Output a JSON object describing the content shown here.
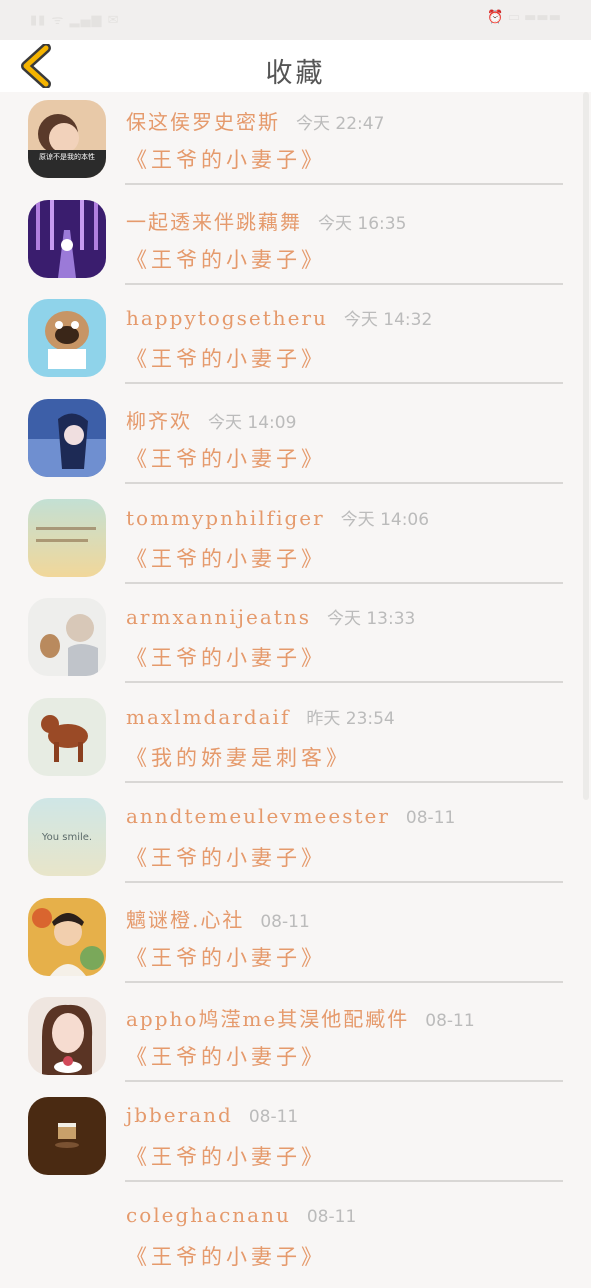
{
  "header": {
    "title": "收藏",
    "back_icon": "chevron-left-icon",
    "accent_color": "#f5b400"
  },
  "colors": {
    "text_accent": "#e59a6c",
    "time_gray": "#bbbbbb"
  },
  "favorites": [
    {
      "user": "保这侯罗史密斯",
      "time": "今天 22:47",
      "work": "《王爷的小妻子》",
      "avatar": "woman-portrait-avatar",
      "avatar_caption": "原谅不是我的本性"
    },
    {
      "user": "一起透来伴跳藕舞",
      "time": "今天 16:35",
      "work": "《王爷的小妻子》",
      "avatar": "purple-hall-avatar"
    },
    {
      "user": "happytogsetheru",
      "time": "今天 14:32",
      "work": "《王爷的小妻子》",
      "avatar": "pug-dog-avatar"
    },
    {
      "user": "柳齐欢",
      "time": "今天 14:09",
      "work": "《王爷的小妻子》",
      "avatar": "anime-girl-avatar"
    },
    {
      "user": "tommypnhilfiger",
      "time": "今天 14:06",
      "work": "《王爷的小妻子》",
      "avatar": "text-card-avatar"
    },
    {
      "user": "armxannijeatns",
      "time": "今天 13:33",
      "work": "《王爷的小妻子》",
      "avatar": "anime-boy-avatar"
    },
    {
      "user": "maxlmdardaif",
      "time": "昨天 23:54",
      "work": "《我的娇妻是刺客》",
      "avatar": "puppy-avatar"
    },
    {
      "user": "anndtemeulevmeester",
      "time": "08-11",
      "work": "《王爷的小妻子》",
      "avatar": "smile-sky-avatar",
      "avatar_caption": "You smile."
    },
    {
      "user": "魑谜橙.心社",
      "time": "08-11",
      "work": "《王爷的小妻子》",
      "avatar": "boy-painting-avatar"
    },
    {
      "user": "appho鸠滢me其淏他配臧件",
      "time": "08-11",
      "work": "《王爷的小妻子》",
      "avatar": "girl-cake-avatar"
    },
    {
      "user": "jbberand",
      "time": "08-11",
      "work": "《王爷的小妻子》",
      "avatar": "cake-slice-avatar"
    },
    {
      "user": "coleghacnanu",
      "time": "08-11",
      "work": "《王爷的小妻子》",
      "avatar": "blank-avatar"
    }
  ]
}
